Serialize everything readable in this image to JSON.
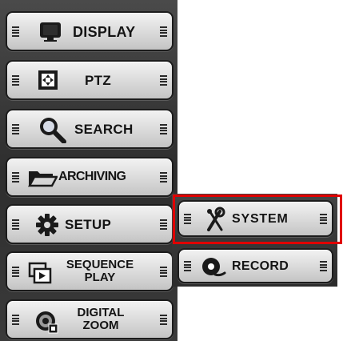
{
  "main_menu": {
    "items": [
      {
        "key": "display",
        "label": "DISPLAY",
        "icon": "monitor-icon"
      },
      {
        "key": "ptz",
        "label": "PTZ",
        "icon": "ptz-icon"
      },
      {
        "key": "search",
        "label": "SEARCH",
        "icon": "magnifier-icon"
      },
      {
        "key": "archiving",
        "label": "ARCHIVING",
        "icon": "folder-icon"
      },
      {
        "key": "setup",
        "label": "SETUP",
        "icon": "gear-icon"
      },
      {
        "key": "sequence",
        "label_line1": "SEQUENCE",
        "label_line2": "PLAY",
        "icon": "sequence-play-icon"
      },
      {
        "key": "digital_zoom",
        "label_line1": "DIGITAL",
        "label_line2": "ZOOM",
        "icon": "digital-zoom-icon"
      }
    ]
  },
  "setup_submenu": {
    "items": [
      {
        "key": "system",
        "label": "SYSTEM",
        "icon": "wrench-screwdriver-icon"
      },
      {
        "key": "record",
        "label": "RECORD",
        "icon": "record-icon"
      }
    ]
  },
  "highlight": {
    "target": "SYSTEM",
    "color": "#e00000"
  }
}
